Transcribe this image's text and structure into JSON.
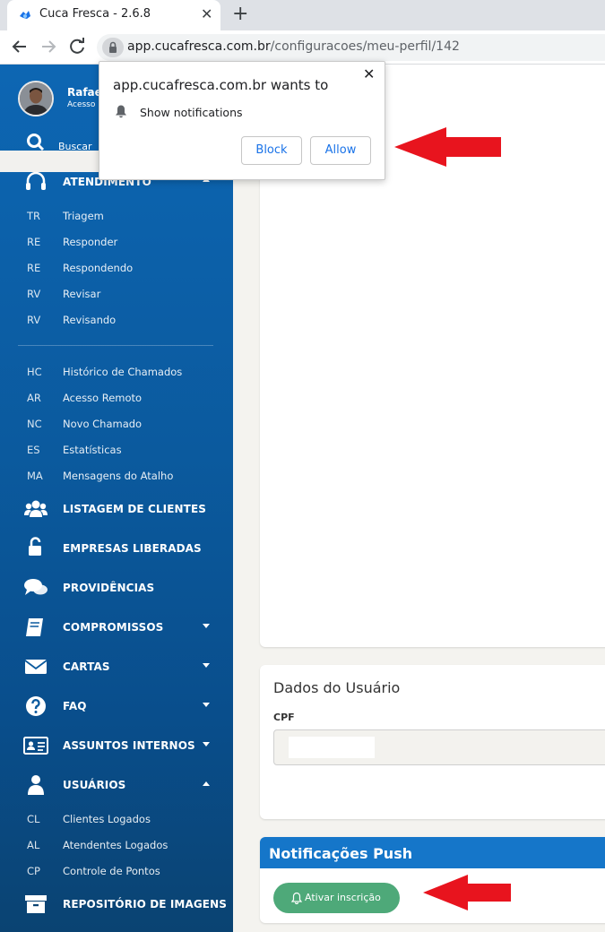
{
  "browser": {
    "tab_title": "Cuca Fresca - 2.6.8",
    "tab_close": "✕",
    "new_tab": "+",
    "url_host": "app.cucafresca.com.br",
    "url_path": "/configuracoes/meu-perfil/142"
  },
  "prompt": {
    "title": "app.cucafresca.com.br wants to",
    "permission": "Show notifications",
    "close": "✕",
    "block_label": "Block",
    "allow_label": "Allow"
  },
  "sidebar": {
    "user_name": "Rafae",
    "user_role": "Acesso",
    "search_label": "Buscar",
    "atendimento": {
      "label": "ATENDIMENTO",
      "items": [
        {
          "abbr": "TR",
          "label": "Triagem"
        },
        {
          "abbr": "RE",
          "label": "Responder"
        },
        {
          "abbr": "RE",
          "label": "Respondendo"
        },
        {
          "abbr": "RV",
          "label": "Revisar"
        },
        {
          "abbr": "RV",
          "label": "Revisando"
        }
      ]
    },
    "tools": [
      {
        "abbr": "HC",
        "label": "Histórico de Chamados"
      },
      {
        "abbr": "AR",
        "label": "Acesso Remoto"
      },
      {
        "abbr": "NC",
        "label": "Novo Chamado"
      },
      {
        "abbr": "ES",
        "label": "Estatísticas"
      },
      {
        "abbr": "MA",
        "label": "Mensagens do Atalho"
      }
    ],
    "menu": [
      {
        "label": "LISTAGEM DE CLIENTES",
        "icon": "users-icon"
      },
      {
        "label": "EMPRESAS LIBERADAS",
        "icon": "unlock-icon"
      },
      {
        "label": "PROVIDÊNCIAS",
        "icon": "comments-icon"
      },
      {
        "label": "COMPROMISSOS",
        "icon": "book-icon"
      },
      {
        "label": "CARTAS",
        "icon": "envelope-icon"
      },
      {
        "label": "FAQ",
        "icon": "question-icon"
      },
      {
        "label": "ASSUNTOS INTERNOS",
        "icon": "id-card-icon"
      },
      {
        "label": "USUÁRIOS",
        "icon": "user-icon"
      }
    ],
    "usuarios_items": [
      {
        "abbr": "CL",
        "label": "Clientes Logados"
      },
      {
        "abbr": "AL",
        "label": "Atendentes Logados"
      },
      {
        "abbr": "CP",
        "label": "Controle de Pontos"
      }
    ],
    "repositorio": {
      "label": "REPOSITÓRIO DE IMAGENS",
      "icon": "archive-icon"
    }
  },
  "main": {
    "user_data": {
      "title": "Dados do Usuário",
      "cpf_label": "CPF",
      "cpf_value": ""
    },
    "push": {
      "title": "Notificações Push",
      "button_label": "Ativar inscrição"
    }
  },
  "colors": {
    "sidebar": "#0b5a9e",
    "push_header": "#1576c9",
    "push_button": "#4ea979",
    "annotation_arrow": "#e8141e"
  }
}
